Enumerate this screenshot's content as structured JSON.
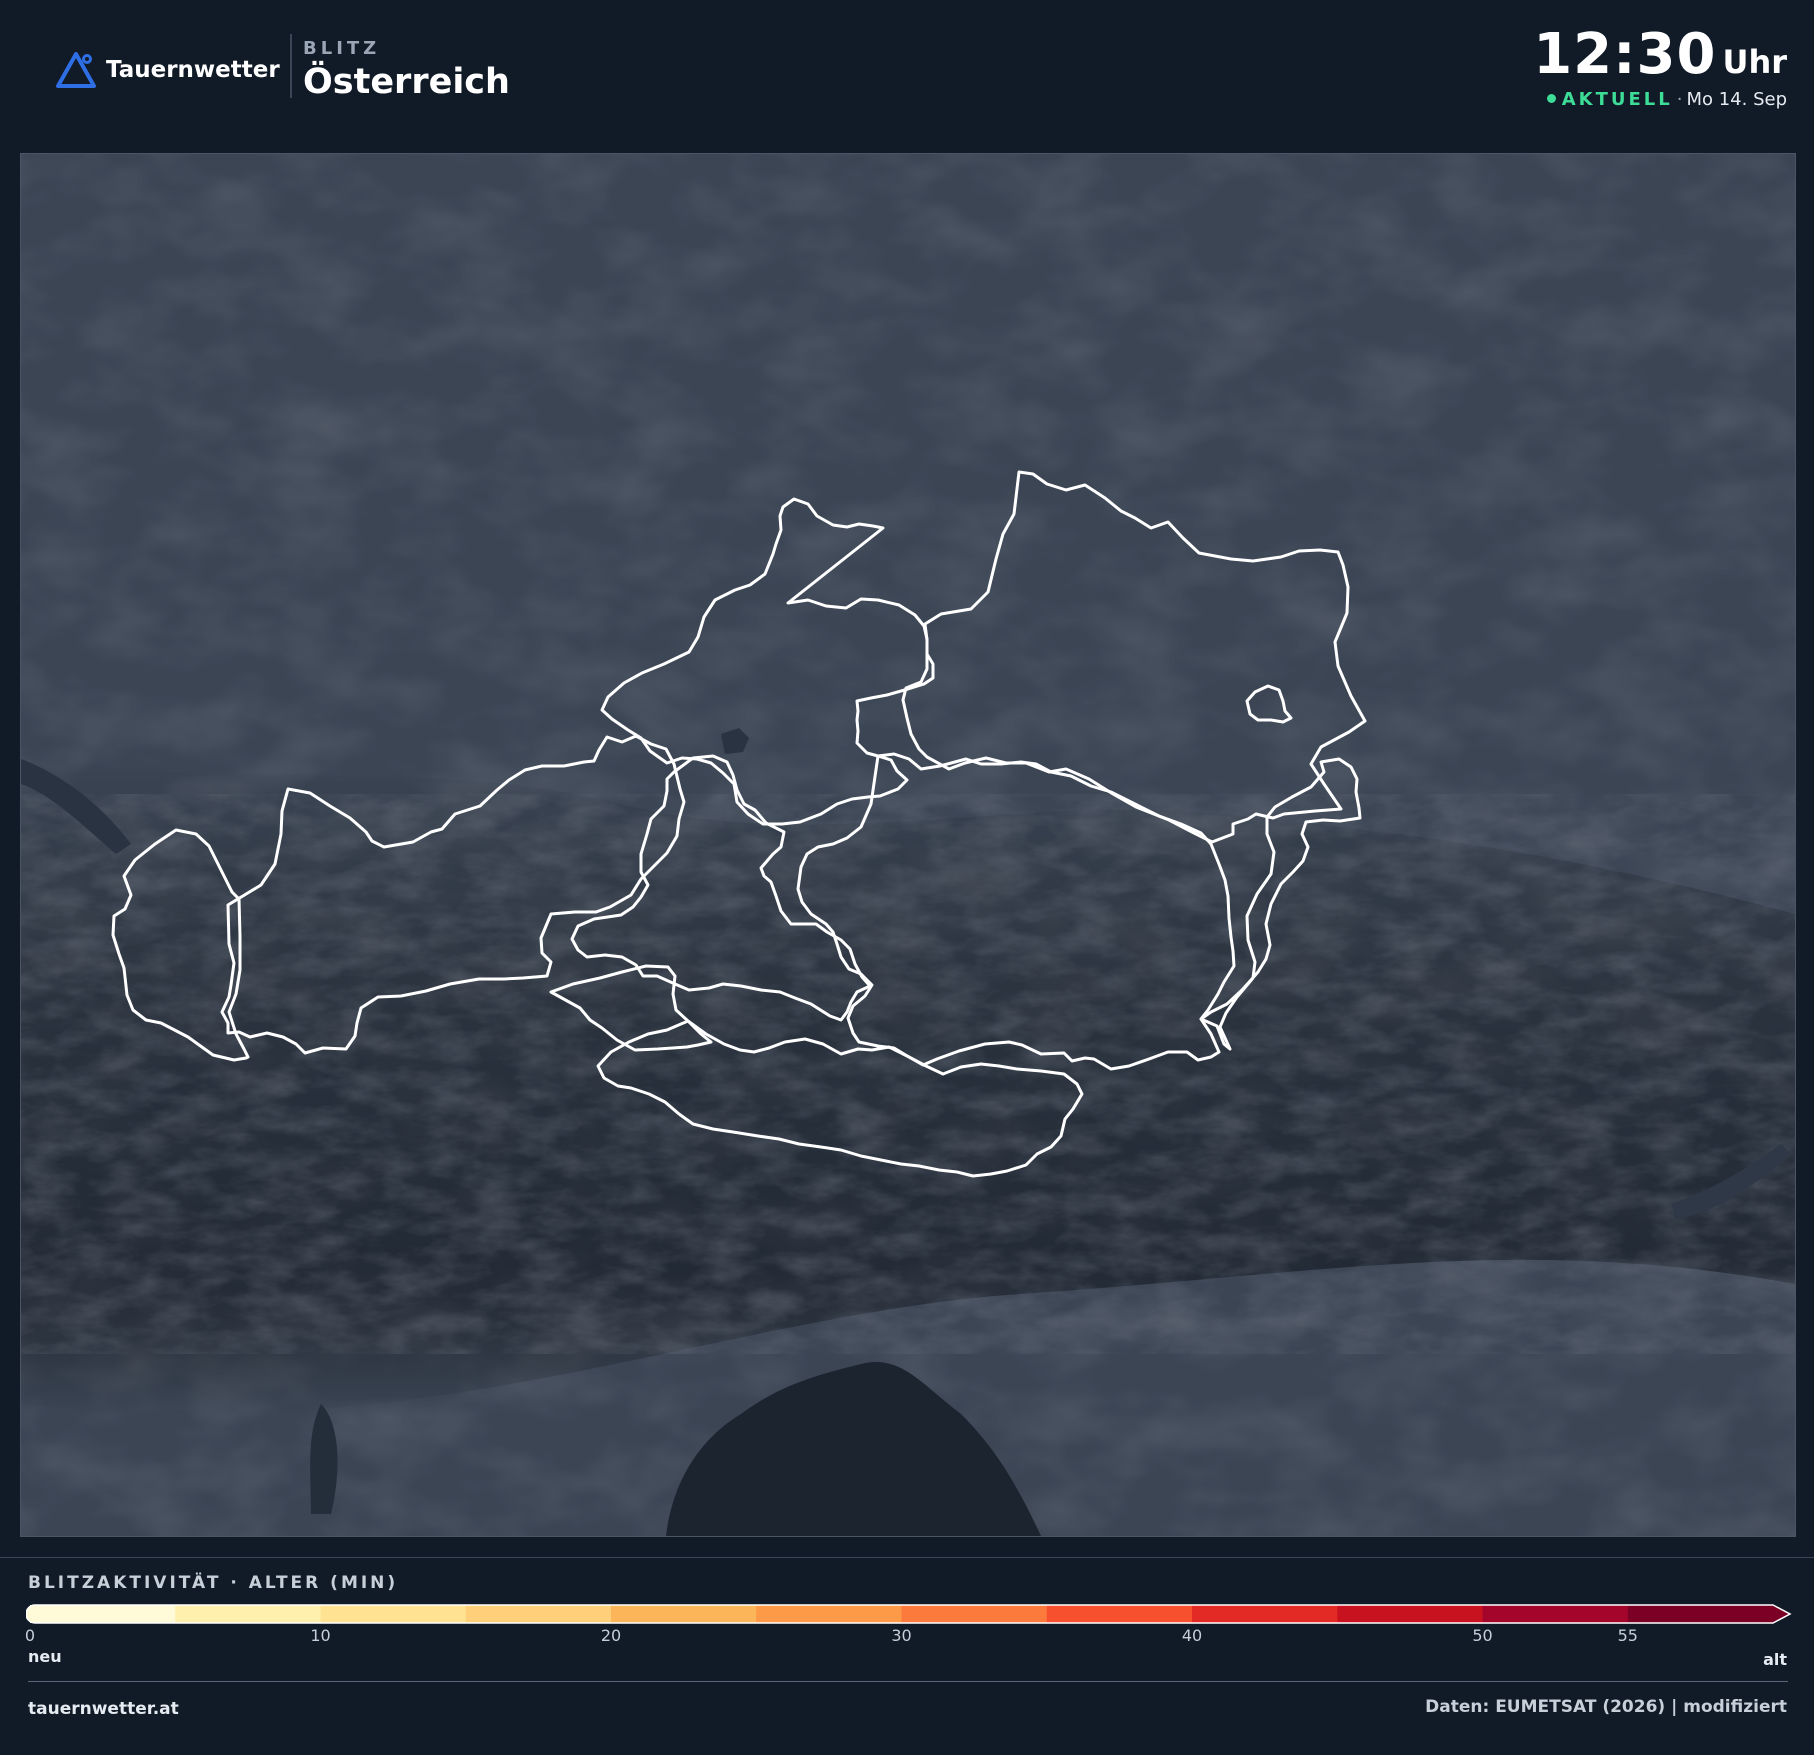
{
  "brand": {
    "name": "Tauernwetter",
    "icon": "mountain-pin-logo-icon",
    "accent": "#2f6fe6"
  },
  "product": {
    "kicker": "BLITZ",
    "title": "Österreich"
  },
  "time": {
    "value": "12:30",
    "unit": "Uhr",
    "status": "AKTUELL",
    "separator": "·",
    "date": "Mo 14. Sep",
    "status_color": "#3ddc97"
  },
  "map": {
    "region": "Österreich",
    "layers": [
      "dark-relief-basemap",
      "state-borders"
    ],
    "border_color": "#ffffff"
  },
  "legend": {
    "title": "BLITZAKTIVITÄT · ALTER (MIN)",
    "min_label": "neu",
    "max_label": "alt",
    "ticks": [
      "0",
      "10",
      "20",
      "30",
      "40",
      "50",
      "55"
    ],
    "tick_values": [
      0,
      10,
      20,
      30,
      40,
      50,
      55
    ],
    "range": [
      0,
      60
    ],
    "colors": [
      "#fffbd9",
      "#fff0ae",
      "#ffe392",
      "#ffd079",
      "#fdb55a",
      "#fd9a48",
      "#fc7a3b",
      "#f6502e",
      "#e42a24",
      "#c8121f",
      "#a4062b",
      "#7c0026"
    ]
  },
  "footer": {
    "site": "tauernwetter.at",
    "credit": "Daten: EUMETSAT (2026) | modifiziert"
  }
}
